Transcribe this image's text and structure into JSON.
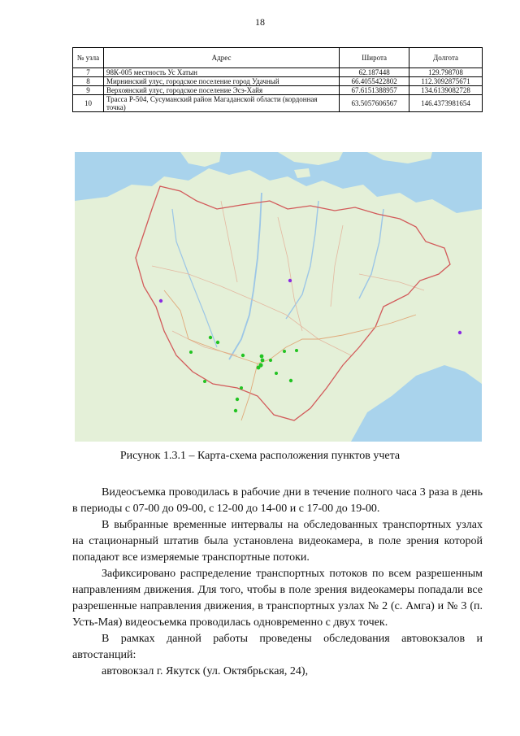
{
  "page_number": "18",
  "table": {
    "headers": [
      "№ узла",
      "Адрес",
      "Широта",
      "Долгота"
    ],
    "rows": [
      [
        "7",
        "98К-005 местность Ус Хатын",
        "62.187448",
        "129.798708"
      ],
      [
        "8",
        "Мирнинский улус, городское поселение город Удачный",
        "66.4055422802",
        "112.3092875671"
      ],
      [
        "9",
        "Верхоянский улус, городское поселение Эсэ-Хайя",
        "67.6151388957",
        "134.6139082728"
      ],
      [
        "10",
        "Трасса Р-504, Сусуманский район Магаданской области (кордонная точка)",
        "63.5057606567",
        "146.4373981654"
      ]
    ]
  },
  "figure": {
    "caption": "Рисунок 1.3.1 – Карта-схема расположения пунктов учета"
  },
  "paragraphs": [
    "Видеосъемка проводилась в рабочие дни в течение полного часа 3 раза в день в периоды с 07-00 до 09-00, с 12-00 до 14-00 и с 17-00 до 19-00.",
    "В выбранные временные интервалы на обследованных транспортных узлах на стационарный штатив была установлена видеокамера, в поле зрения которой попадают все измеряемые транспортные потоки.",
    "Зафиксировано распределение транспортных потоков по всем разрешенным направлениям движения. Для того, чтобы в поле зрения видеокамеры попадали все разрешенные направления движения, в транспортных узлах № 2 (с. Амга) и № 3 (п. Усть-Мая) видеосъемка проводилась одновременно с двух точек.",
    "В рамках данной работы проведены обследования автовокзалов и автостанций:",
    "автовокзал г. Якутск (ул. Октябрьская, 24),"
  ],
  "colors": {
    "sea": "#a9d3ec",
    "land": "#e4f0d8",
    "region_border": "#d25a5a",
    "river": "#9cc6e6",
    "count_point": "#22c322",
    "special_point": "#8a2be2"
  }
}
